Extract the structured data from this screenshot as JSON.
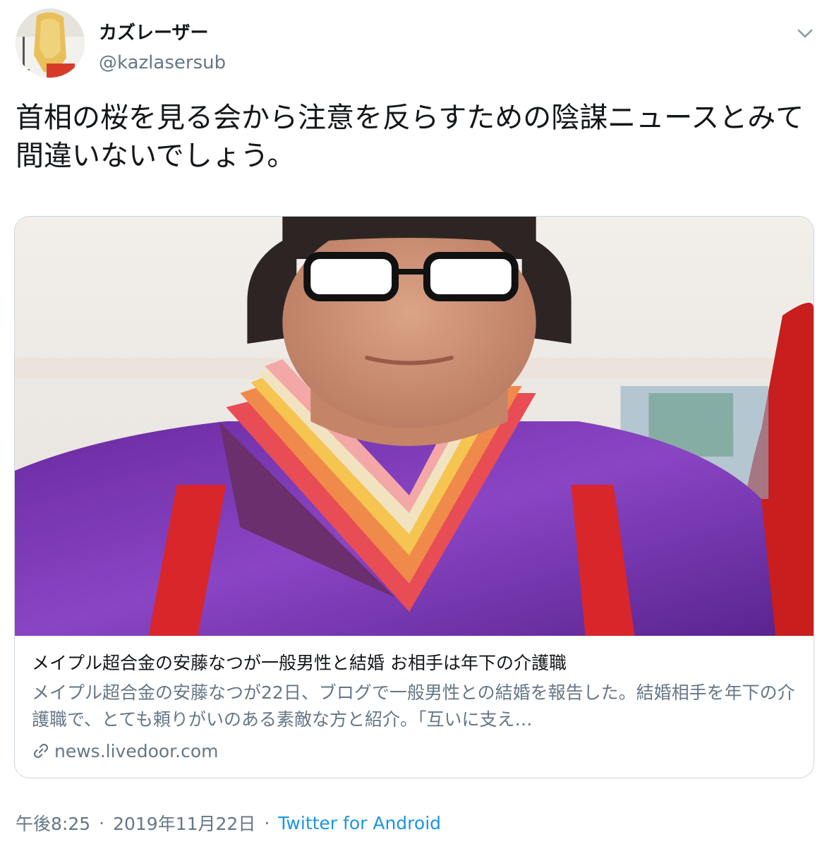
{
  "author": {
    "display_name": "カズレーザー",
    "handle": "@kazlasersub"
  },
  "tweet": {
    "text": "首相の桜を見る会から注意を反らすための陰謀ニュースとみて間違いないでしょう。"
  },
  "card": {
    "title": "メイプル超合金の安藤なつが一般男性と結婚 お相手は年下の介護職",
    "description": "メイプル超合金の安藤なつが22日、ブログで一般男性との結婚を報告した。結婚相手を年下の介護職で、とても頼りがいのある素敵な方と紹介。「互いに支え…",
    "domain": "news.livedoor.com",
    "link_icon": "link-icon"
  },
  "meta": {
    "time": "午後8:25",
    "separator": "·",
    "date": "2019年11月22日",
    "source": "Twitter for Android"
  },
  "icons": {
    "menu": "chevron-down-icon"
  },
  "colors": {
    "text": "#14171a",
    "secondary": "#657786",
    "link": "#1b95e0",
    "border": "#ccd6dd"
  }
}
